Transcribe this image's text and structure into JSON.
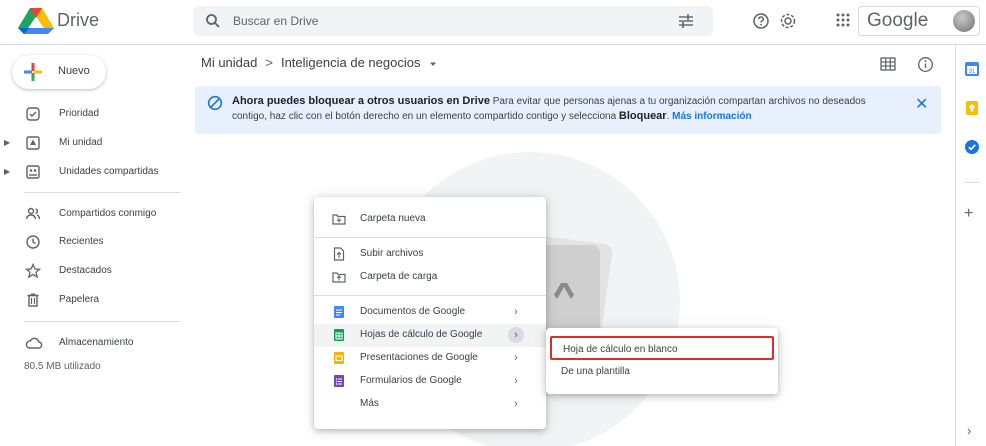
{
  "app": {
    "title": "Drive"
  },
  "search": {
    "placeholder": "Buscar en Drive"
  },
  "account": {
    "logo_text": "Google"
  },
  "sidebar": {
    "new_label": "Nuevo",
    "items": [
      {
        "label": "Prioridad",
        "icon": "priority-icon"
      },
      {
        "label": "Mi unidad",
        "icon": "my-drive-icon"
      },
      {
        "label": "Unidades compartidas",
        "icon": "shared-drives-icon"
      },
      {
        "label": "Compartidos conmigo",
        "icon": "shared-with-me-icon"
      },
      {
        "label": "Recientes",
        "icon": "clock-icon"
      },
      {
        "label": "Destacados",
        "icon": "star-icon"
      },
      {
        "label": "Papelera",
        "icon": "trash-icon"
      },
      {
        "label": "Almacenamiento",
        "icon": "cloud-icon"
      }
    ],
    "storage_used": "80.5 MB utilizado"
  },
  "breadcrumb": {
    "root": "Mi unidad",
    "separator": ">",
    "current": "Inteligencia de negocios"
  },
  "banner": {
    "title": "Ahora puedes bloquear a otros usuarios en Drive",
    "body_1": " Para evitar que personas ajenas a tu organización compartan archivos no deseados contigo, haz clic con el botón derecho en un elemento compartido contigo y selecciona ",
    "bold": "Bloquear",
    "body_2": ". ",
    "link": "Más información",
    "close": "✕"
  },
  "context_menu": {
    "items": [
      {
        "label": "Carpeta nueva"
      },
      {
        "label": "Subir archivos"
      },
      {
        "label": "Carpeta de carga"
      },
      {
        "label": "Documentos de Google"
      },
      {
        "label": "Hojas de cálculo de Google"
      },
      {
        "label": "Presentaciones de Google"
      },
      {
        "label": "Formularios de Google"
      },
      {
        "label": "Más"
      }
    ],
    "chevron": "›"
  },
  "submenu": {
    "items": [
      {
        "label": "Hoja de cálculo en blanco"
      },
      {
        "label": "De una plantilla"
      }
    ]
  },
  "colors": {
    "accent": "#1a73e8",
    "highlight_border": "#d93025",
    "banner_bg": "#e8f0fe"
  }
}
